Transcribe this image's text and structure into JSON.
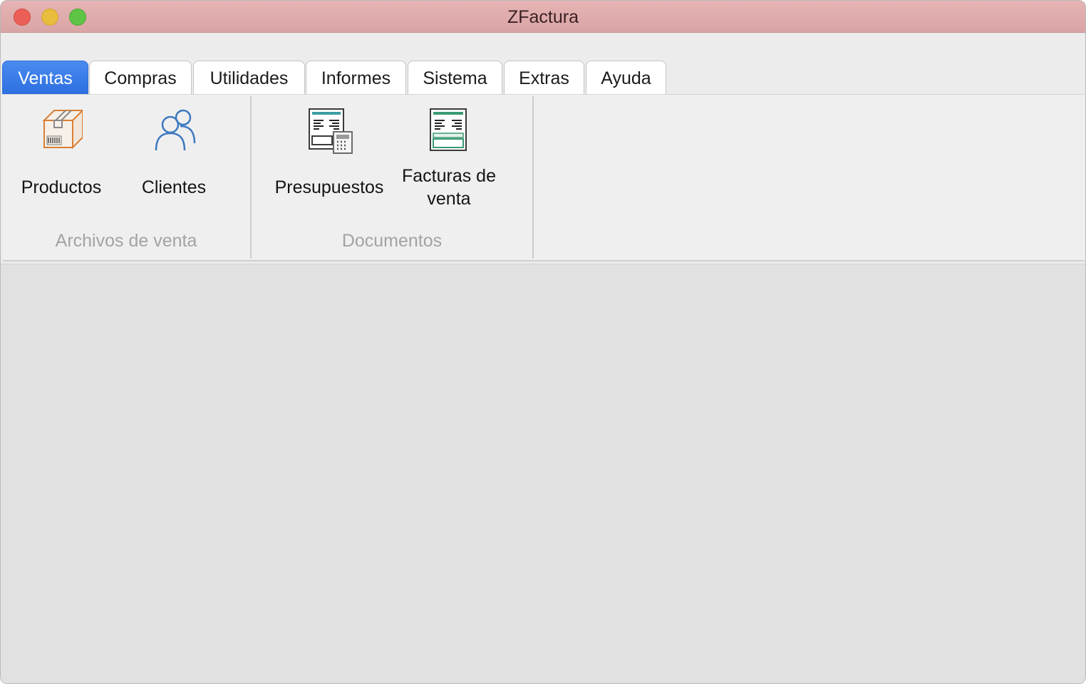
{
  "window": {
    "title": "ZFactura"
  },
  "tabs": [
    {
      "label": "Ventas",
      "active": true
    },
    {
      "label": "Compras",
      "active": false
    },
    {
      "label": "Utilidades",
      "active": false
    },
    {
      "label": "Informes",
      "active": false
    },
    {
      "label": "Sistema",
      "active": false
    },
    {
      "label": "Extras",
      "active": false
    },
    {
      "label": "Ayuda",
      "active": false
    }
  ],
  "ribbon": {
    "groups": [
      {
        "label": "Archivos de venta",
        "buttons": [
          {
            "label": "Productos",
            "icon": "box-icon"
          },
          {
            "label": "Clientes",
            "icon": "users-icon"
          }
        ]
      },
      {
        "label": "Documentos",
        "buttons": [
          {
            "label": "Presupuestos",
            "icon": "quote-calculator-icon"
          },
          {
            "label": "Facturas de venta",
            "icon": "invoice-icon"
          }
        ]
      }
    ]
  },
  "colors": {
    "titlebar": "#dca9aa",
    "active_tab": "#2c6fe0",
    "content_background": "#e1e1e1"
  }
}
